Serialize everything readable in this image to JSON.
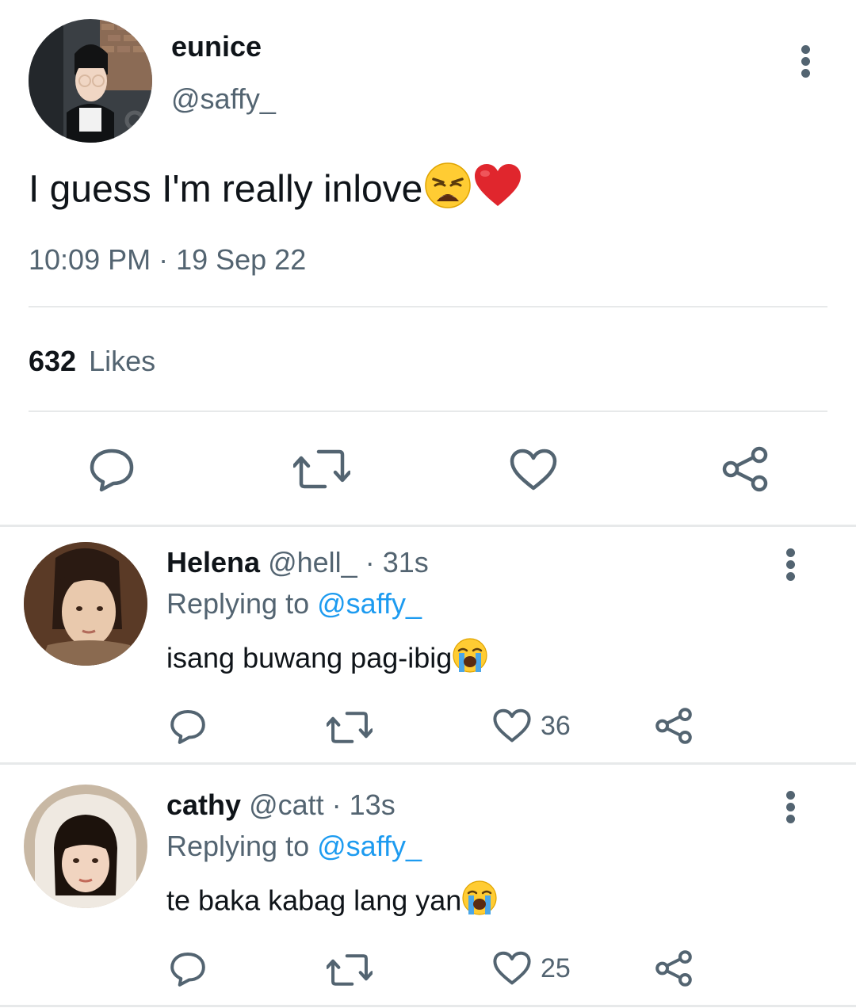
{
  "tweet": {
    "author_name": "eunice",
    "author_handle": "@saffy_",
    "text": "I guess I'm really inlove",
    "text_emojis": [
      "weary-face-emoji",
      "red-heart-emoji"
    ],
    "timestamp": "10:09 PM · 19 Sep 22",
    "likes_count": "632",
    "likes_label": "Likes",
    "actions": [
      "reply-icon",
      "retweet-icon",
      "like-icon",
      "share-icon"
    ]
  },
  "replies": [
    {
      "name": "Helena",
      "handle": "@hell_",
      "time": "· 31s",
      "replying_prefix": "Replying to",
      "replying_handle": "@saffy_",
      "text": "isang buwang pag-ibig",
      "text_emoji": "loudly-crying-face-emoji",
      "likes": "36"
    },
    {
      "name": "cathy",
      "handle": "@catt",
      "time": "· 13s",
      "replying_prefix": "Replying to",
      "replying_handle": "@saffy_",
      "text": "te baka kabag lang yan",
      "text_emoji": "loudly-crying-face-emoji",
      "likes": "25"
    }
  ],
  "colors": {
    "text": "#0f1419",
    "muted": "#536471",
    "link": "#1d9bf0",
    "divider": "#e7e9ea",
    "heart": "#e0245e"
  }
}
